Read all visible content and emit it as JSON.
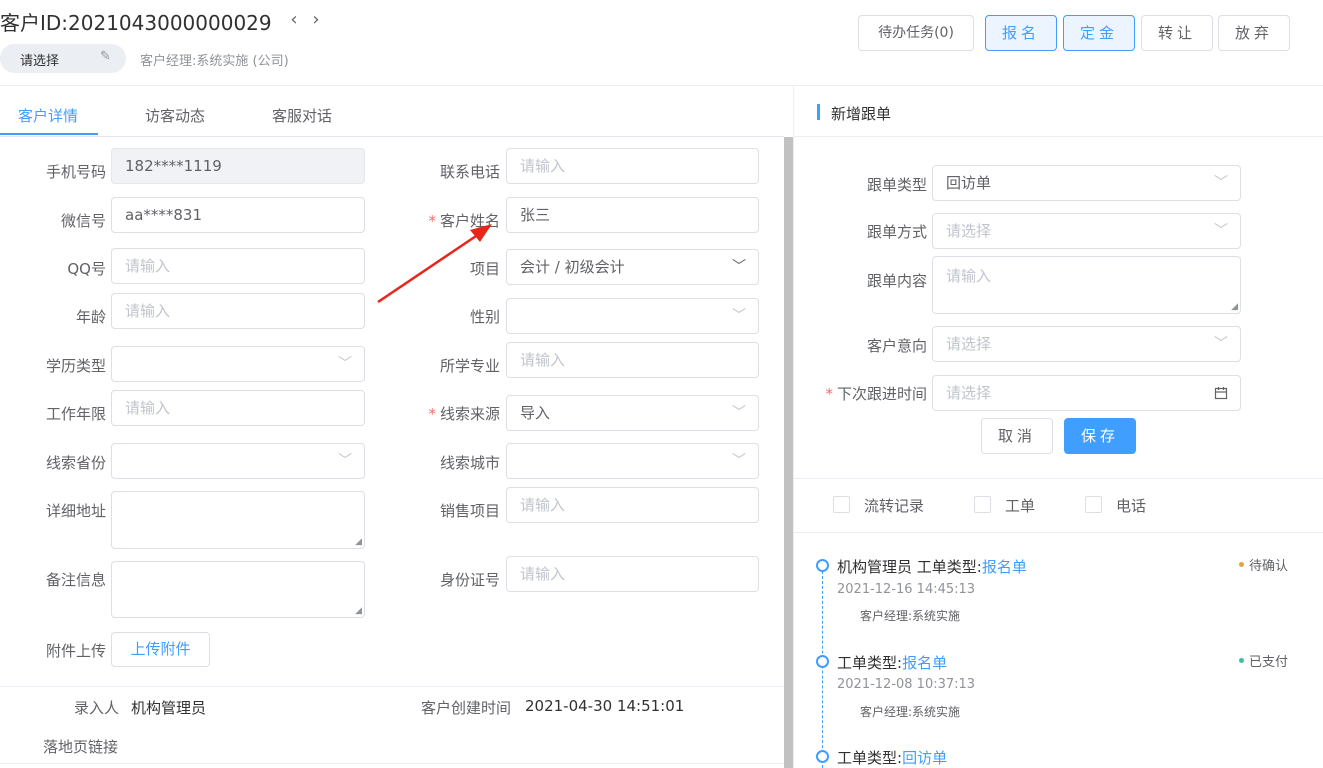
{
  "header": {
    "customer_id": "客户ID:2021043000000029",
    "prev": "‹",
    "next": "›",
    "status_select": "请选择",
    "manager": "客户经理:系统实施 (公司)",
    "buttons": {
      "todo": "待办任务(0)",
      "enroll": "报名",
      "deposit": "定金",
      "transfer": "转让",
      "abandon": "放弃"
    }
  },
  "tabs": [
    {
      "label": "客户详情",
      "active": true
    },
    {
      "label": "访客动态",
      "active": false
    },
    {
      "label": "客服对话",
      "active": false
    }
  ],
  "form": {
    "phone": {
      "label": "手机号码",
      "value": "182****1119"
    },
    "contact_phone": {
      "label": "联系电话",
      "placeholder": "请输入"
    },
    "wechat": {
      "label": "微信号",
      "value": "aa****831"
    },
    "customer_name": {
      "label": "客户姓名",
      "value": "张三",
      "required": "*"
    },
    "qq": {
      "label": "QQ号",
      "placeholder": "请输入"
    },
    "project": {
      "label": "项目",
      "value": "会计 / 初级会计"
    },
    "age": {
      "label": "年龄",
      "placeholder": "请输入"
    },
    "gender": {
      "label": "性别",
      "value": ""
    },
    "education": {
      "label": "学历类型",
      "value": ""
    },
    "major": {
      "label": "所学专业",
      "placeholder": "请输入"
    },
    "work_years": {
      "label": "工作年限",
      "placeholder": "请输入"
    },
    "lead_source": {
      "label": "线索来源",
      "value": "导入",
      "required": "*"
    },
    "lead_province": {
      "label": "线索省份",
      "value": ""
    },
    "lead_city": {
      "label": "线索城市",
      "value": ""
    },
    "address": {
      "label": "详细地址",
      "value": ""
    },
    "sales_project": {
      "label": "销售项目",
      "placeholder": "请输入"
    },
    "remarks": {
      "label": "备注信息",
      "value": ""
    },
    "id_number": {
      "label": "身份证号",
      "placeholder": "请输入"
    },
    "attachment": {
      "label": "附件上传",
      "button": "上传附件"
    }
  },
  "meta": {
    "entered_by_label": "录入人",
    "entered_by": "机构管理员",
    "created_label": "客户创建时间",
    "created_time": "2021-04-30 14:51:01",
    "landing_label": "落地页链接"
  },
  "followup": {
    "title": "新增跟单",
    "type": {
      "label": "跟单类型",
      "value": "回访单"
    },
    "method": {
      "label": "跟单方式",
      "placeholder": "请选择"
    },
    "content": {
      "label": "跟单内容",
      "placeholder": "请输入"
    },
    "intent": {
      "label": "客户意向",
      "placeholder": "请选择"
    },
    "next_time": {
      "label": "下次跟进时间",
      "placeholder": "请选择",
      "required": "*"
    },
    "cancel": "取消",
    "save": "保存"
  },
  "filters": [
    {
      "label": "流转记录",
      "checked": false
    },
    {
      "label": "工单",
      "checked": false
    },
    {
      "label": "电话",
      "checked": false
    }
  ],
  "timeline": [
    {
      "prefix": "机构管理员 工单类型:",
      "link": "报名单",
      "time": "2021-12-16 14:45:13",
      "manager": "客户经理:系统实施",
      "status": "待确认",
      "status_color": "#e6a23c"
    },
    {
      "prefix": "工单类型:",
      "link": "报名单",
      "time": "2021-12-08 10:37:13",
      "manager": "客户经理:系统实施",
      "status": "已支付",
      "status_color": "#36c1a0"
    },
    {
      "prefix": "工单类型:",
      "link": "回访单"
    }
  ],
  "colors": {
    "accent": "#409eff",
    "required": "#f56c6c"
  }
}
